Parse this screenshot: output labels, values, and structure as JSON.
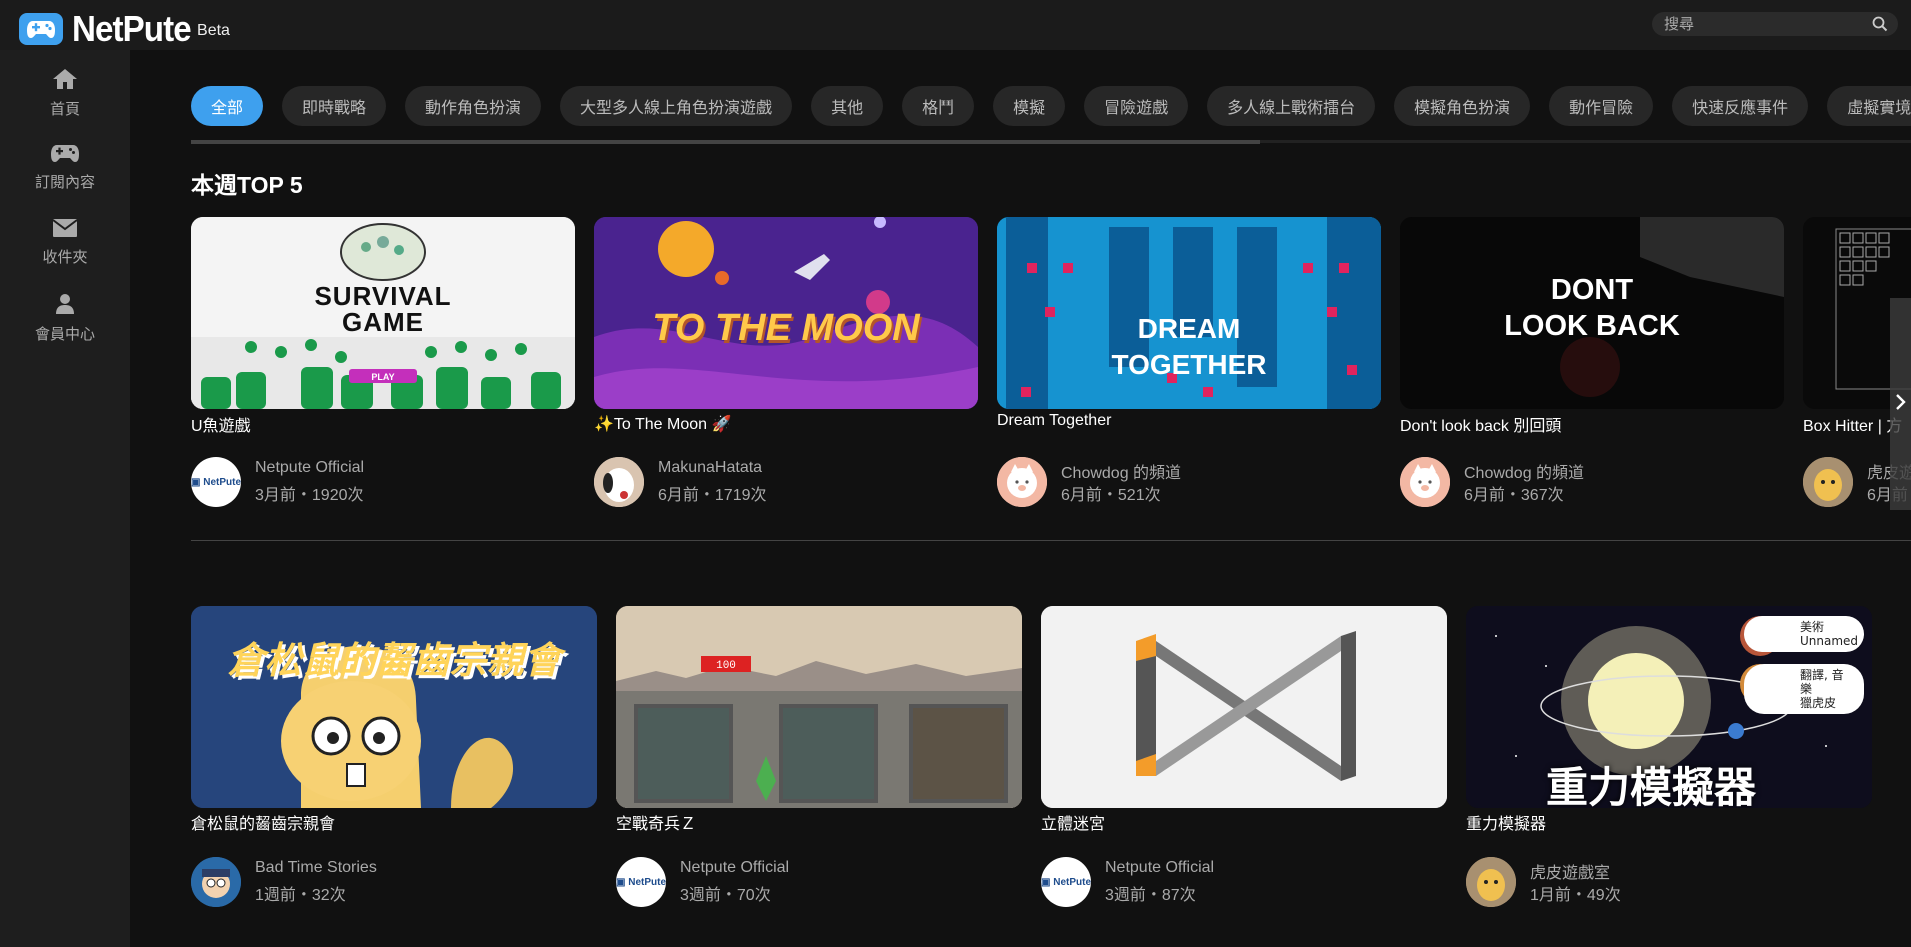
{
  "header": {
    "brand": "NetPute",
    "badge": "Beta",
    "search_placeholder": "搜尋"
  },
  "sidebar": {
    "items": [
      {
        "label": "首頁",
        "icon": "home-icon"
      },
      {
        "label": "訂閱內容",
        "icon": "gamepad-icon"
      },
      {
        "label": "收件夾",
        "icon": "mail-icon"
      },
      {
        "label": "會員中心",
        "icon": "user-icon"
      }
    ]
  },
  "categories": [
    "全部",
    "即時戰略",
    "動作角色扮演",
    "大型多人線上角色扮演遊戲",
    "其他",
    "格鬥",
    "模擬",
    "冒險遊戲",
    "多人線上戰術擂台",
    "模擬角色扮演",
    "動作冒險",
    "快速反應事件",
    "虛擬實境"
  ],
  "top5": {
    "title": "本週TOP 5",
    "games": [
      {
        "title": "U魚遊戲",
        "channel": "Netpute Official",
        "meta": "3月前・1920次",
        "thumb_text": [
          "SURVIVAL",
          "GAME"
        ]
      },
      {
        "title": "✨To The Moon 🚀",
        "channel": "MakunaHatata",
        "meta": "6月前・1719次",
        "thumb_text": [
          "TO THE MOON"
        ]
      },
      {
        "title": "Dream Together",
        "channel": "Chowdog 的頻道",
        "meta": "6月前・521次",
        "thumb_text": [
          "DREAM",
          "TOGETHER"
        ]
      },
      {
        "title": "Don't look back 別回頭",
        "channel": "Chowdog 的頻道",
        "meta": "6月前・367次",
        "thumb_text": [
          "DONT",
          "LOOK BACK"
        ]
      },
      {
        "title": "Box Hitter | 方",
        "channel": "虎皮遊",
        "meta": "6月前"
      }
    ]
  },
  "latest": {
    "games": [
      {
        "title": "倉松鼠的齧齒宗親會",
        "channel": "Bad Time Stories",
        "meta": "1週前・32次",
        "thumb_text": [
          "倉松鼠的齧齒宗親會"
        ]
      },
      {
        "title": "空戰奇兵Ｚ",
        "channel": "Netpute Official",
        "meta": "3週前・70次"
      },
      {
        "title": "立體迷宮",
        "channel": "Netpute Official",
        "meta": "3週前・87次"
      },
      {
        "title": "重力模擬器",
        "channel": "虎皮遊戲室",
        "meta": "1月前・49次",
        "thumb_text": [
          "重力模擬器"
        ],
        "planet_labels": [
          [
            "美術",
            "Unnamed"
          ],
          [
            "翻譯, 音樂",
            "獵虎皮"
          ]
        ]
      }
    ]
  },
  "colors": {
    "accent": "#3ea0ee",
    "background": "#111111",
    "sidebar": "#1e1e1e"
  }
}
